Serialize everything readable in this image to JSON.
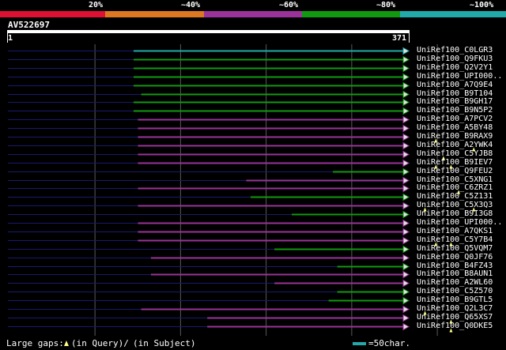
{
  "colors": {
    "background": "#000000",
    "dark_line": "#191970",
    "purple": "#993399",
    "green": "#119911",
    "cyan": "#22aaaa",
    "red": "#dd1133",
    "orange": "#dd7722",
    "white": "#ffffff",
    "grid": "#5a5a5a",
    "triangle_fill": "#e0e0e0",
    "gap_marker": "#ffff88"
  },
  "legend_bar": {
    "labels": [
      "20%",
      "~40%",
      "~60%",
      "~80%",
      "~100%"
    ],
    "colors": [
      "#dd1133",
      "#dd7722",
      "#993399",
      "#119911",
      "#22aaaa"
    ]
  },
  "query": {
    "id": "AV522697",
    "start_label": "1",
    "end_label": "371"
  },
  "hits": [
    {
      "name": "UniRef100_C0LGR3",
      "color": "cyan",
      "start": 117,
      "end": 371,
      "gaps": []
    },
    {
      "name": "UniRef100_Q9FKU3",
      "color": "green",
      "start": 117,
      "end": 371,
      "gaps": []
    },
    {
      "name": "UniRef100_Q2V2Y1",
      "color": "green",
      "start": 117,
      "end": 371,
      "gaps": []
    },
    {
      "name": "UniRef100_UPI000..",
      "color": "green",
      "start": 117,
      "end": 371,
      "gaps": []
    },
    {
      "name": "UniRef100_A7Q9E4",
      "color": "green",
      "start": 117,
      "end": 371,
      "gaps": []
    },
    {
      "name": "UniRef100_B9T104",
      "color": "green",
      "start": 124,
      "end": 371,
      "gaps": []
    },
    {
      "name": "UniRef100_B9GH17",
      "color": "green",
      "start": 117,
      "end": 371,
      "gaps": []
    },
    {
      "name": "UniRef100_B9N5P2",
      "color": "green",
      "start": 117,
      "end": 371,
      "gaps": []
    },
    {
      "name": "UniRef100_A7PCV2",
      "color": "purple",
      "start": 121,
      "end": 371,
      "gaps": []
    },
    {
      "name": "UniRef100_A5BY48",
      "color": "purple",
      "start": 121,
      "end": 371,
      "gaps": []
    },
    {
      "name": "UniRef100_B9RAX9",
      "color": "purple",
      "start": 121,
      "end": 371,
      "gaps": [
        396
      ]
    },
    {
      "name": "UniRef100_A2YWK4",
      "color": "purple",
      "start": 121,
      "end": 371,
      "gaps": [
        431
      ]
    },
    {
      "name": "UniRef100_C5YJB8",
      "color": "purple",
      "start": 121,
      "end": 371,
      "gaps": [
        403
      ]
    },
    {
      "name": "UniRef100_B9IEV7",
      "color": "purple",
      "start": 121,
      "end": 371,
      "gaps": [
        396,
        410
      ]
    },
    {
      "name": "UniRef100_Q9FEU2",
      "color": "green",
      "start": 301,
      "end": 371,
      "gaps": []
    },
    {
      "name": "UniRef100_C5XNG1",
      "color": "purple",
      "start": 221,
      "end": 371,
      "gaps": []
    },
    {
      "name": "UniRef100_C6ZRZ1",
      "color": "purple",
      "start": 121,
      "end": 371,
      "gaps": [
        417
      ]
    },
    {
      "name": "UniRef100_C5Z131",
      "color": "green",
      "start": 225,
      "end": 371,
      "gaps": []
    },
    {
      "name": "UniRef100_C5X3Q3",
      "color": "purple",
      "start": 121,
      "end": 371,
      "gaps": [
        386,
        431
      ]
    },
    {
      "name": "UniRef100_B9I3G8",
      "color": "green",
      "start": 263,
      "end": 371,
      "gaps": []
    },
    {
      "name": "UniRef100_UPI000..",
      "color": "purple",
      "start": 121,
      "end": 371,
      "gaps": []
    },
    {
      "name": "UniRef100_A7QKS1",
      "color": "purple",
      "start": 121,
      "end": 371,
      "gaps": []
    },
    {
      "name": "UniRef100_C5Y7B4",
      "color": "purple",
      "start": 121,
      "end": 371,
      "gaps": [
        396,
        410
      ]
    },
    {
      "name": "UniRef100_Q5VQM7",
      "color": "green",
      "start": 247,
      "end": 371,
      "gaps": []
    },
    {
      "name": "UniRef100_Q0JF76",
      "color": "purple",
      "start": 133,
      "end": 371,
      "gaps": []
    },
    {
      "name": "UniRef100_B4FZ43",
      "color": "green",
      "start": 305,
      "end": 371,
      "gaps": []
    },
    {
      "name": "UniRef100_B8AUN1",
      "color": "purple",
      "start": 133,
      "end": 371,
      "gaps": []
    },
    {
      "name": "UniRef100_A2WL60",
      "color": "purple",
      "start": 247,
      "end": 371,
      "gaps": []
    },
    {
      "name": "UniRef100_C5Z570",
      "color": "green",
      "start": 305,
      "end": 371,
      "gaps": []
    },
    {
      "name": "UniRef100_B9GTL5",
      "color": "green",
      "start": 297,
      "end": 371,
      "gaps": []
    },
    {
      "name": "UniRef100_Q2L3C7",
      "color": "purple",
      "start": 124,
      "end": 371,
      "gaps": [
        386
      ]
    },
    {
      "name": "UniRef100_Q65XS7",
      "color": "purple",
      "start": 185,
      "end": 371,
      "gaps": [
        410
      ]
    },
    {
      "name": "UniRef100_Q0DKE5",
      "color": "purple",
      "start": 185,
      "end": 371,
      "gaps": [
        410
      ]
    }
  ],
  "footer": {
    "text_a": "Large gaps:",
    "text_b": "(in Query)/",
    "text_c": "(in Subject)",
    "scale_label": "=50char."
  }
}
